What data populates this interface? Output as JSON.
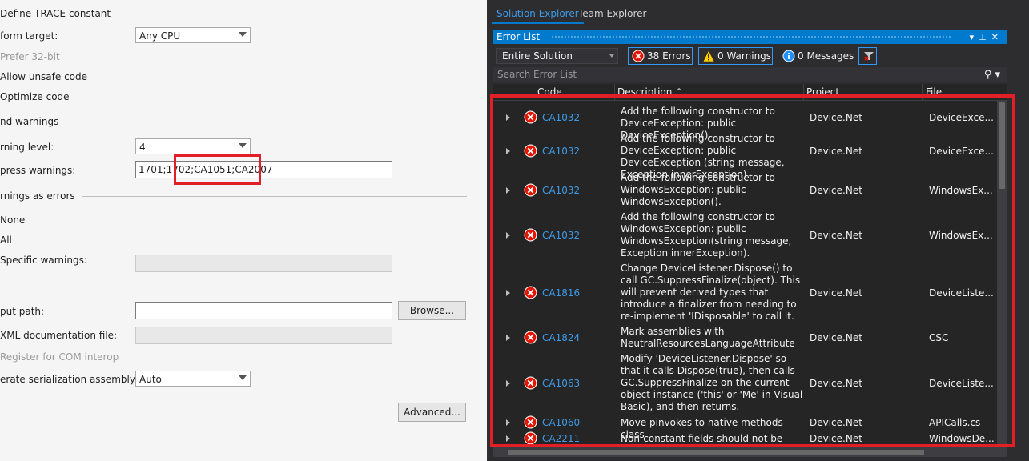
{
  "colors": {
    "accent": "#007acc",
    "error": "#e21f26",
    "link": "#3e9ae6"
  },
  "build": {
    "define_trace": "Define TRACE constant",
    "platform_target_label": "form target:",
    "platform_target_value": "Any CPU",
    "prefer32": "Prefer 32-bit",
    "allow_unsafe": "Allow unsafe code",
    "optimize": "Optimize code",
    "errors_warnings_header": "nd warnings",
    "warning_level_label": "rning level:",
    "warning_level_value": "4",
    "suppress_label": "press warnings:",
    "suppress_value": "1701;1702;CA1051;CA2007",
    "treat_header": "rnings as errors",
    "none": "None",
    "all": "All",
    "specific": "Specific warnings:",
    "output_path_label": "put path:",
    "browse": "Browse...",
    "xmldoc": "XML documentation file:",
    "register_com": "Register for COM interop",
    "gen_serial_label": "erate serialization assembly:",
    "gen_serial_value": "Auto",
    "advanced": "Advanced..."
  },
  "tabs": {
    "solution_explorer": "Solution Explorer",
    "team_explorer": "Team Explorer"
  },
  "error_list": {
    "title": "Error List",
    "scope": "Entire Solution",
    "errors_btn": "38 Errors",
    "warnings_btn": "0 Warnings",
    "messages_btn": "0 Messages",
    "search_placeholder": "Search Error List",
    "columns": {
      "code": "Code",
      "description": "Description",
      "project": "Project",
      "file": "File"
    },
    "rows": [
      {
        "code": "CA1032",
        "description": "Add the following constructor to DeviceException: public DeviceException().",
        "project": "Device.Net",
        "file": "DeviceException.cs"
      },
      {
        "code": "CA1032",
        "description": "Add the following constructor to DeviceException: public DeviceException (string message, Exception innerException).",
        "project": "Device.Net",
        "file": "DeviceException.cs"
      },
      {
        "code": "CA1032",
        "description": "Add the following constructor to WindowsException: public WindowsException().",
        "project": "Device.Net",
        "file": "WindowsException.cs"
      },
      {
        "code": "CA1032",
        "description": "Add the following constructor to WindowsException: public WindowsException(string message, Exception innerException).",
        "project": "Device.Net",
        "file": "WindowsException.cs"
      },
      {
        "code": "CA1816",
        "description": "Change DeviceListener.Dispose() to call GC.SuppressFinalize(object). This will prevent derived types that introduce a finalizer from needing to re-implement 'IDisposable' to call it.",
        "project": "Device.Net",
        "file": "DeviceListener.cs"
      },
      {
        "code": "CA1824",
        "description": "Mark assemblies with NeutralResourcesLanguageAttribute",
        "project": "Device.Net",
        "file": "CSC"
      },
      {
        "code": "CA1063",
        "description": "Modify 'DeviceListener.Dispose' so that it calls Dispose(true), then calls GC.SuppressFinalize on the current object instance ('this' or 'Me' in Visual Basic), and then returns.",
        "project": "Device.Net",
        "file": "DeviceListener.cs"
      },
      {
        "code": "CA1060",
        "description": "Move pinvokes to native methods class",
        "project": "Device.Net",
        "file": "APICalls.cs"
      },
      {
        "code": "CA2211",
        "description": "Non-constant fields should not be visible",
        "project": "Device.Net",
        "file": "WindowsDevice.cs"
      }
    ]
  }
}
